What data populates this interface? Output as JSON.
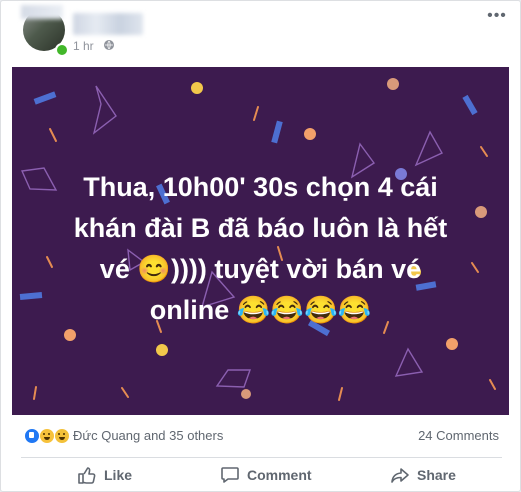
{
  "post": {
    "time": "1 hr",
    "privacy_icon": "globe-icon",
    "more_icon": "more-icon",
    "body_lines": [
      "Thua, 10h00' 30s chọn 4 cái",
      "khán đài B đã báo luôn là hết",
      "vé 😊)))) tuyệt vời bán vé",
      "online 😂😂😂😂"
    ],
    "background_color": "#3d1b4f"
  },
  "footer": {
    "reactions": [
      "like",
      "haha",
      "sad"
    ],
    "reaction_summary": "Đức Quang and 35 others",
    "comments": "24 Comments"
  },
  "actions": {
    "like": "Like",
    "comment": "Comment",
    "share": "Share"
  },
  "colors": {
    "brand_blue": "#2078f4",
    "text_muted": "#606770",
    "online": "#42b72a"
  }
}
